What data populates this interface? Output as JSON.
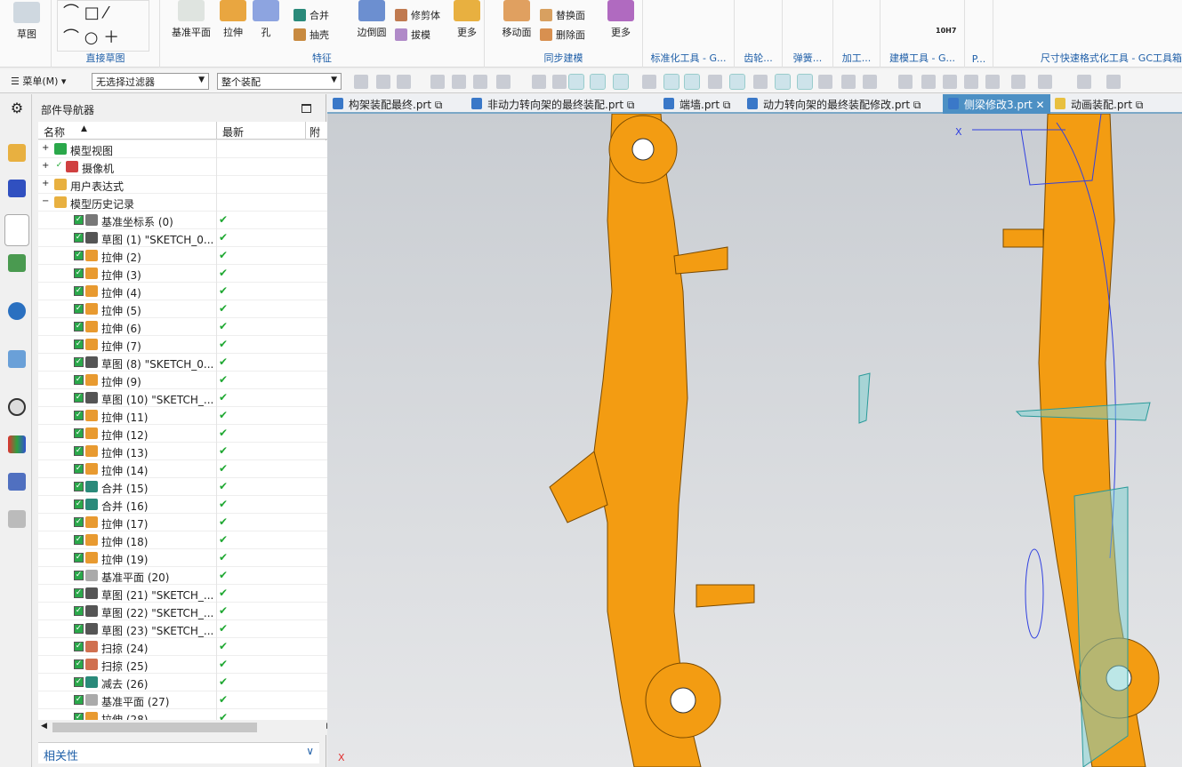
{
  "ribbon": {
    "sketch": "草图",
    "direct_sketch": "直接草图",
    "datum_plane": "基准平面",
    "extrude": "拉伸",
    "hole": "孔",
    "unite": "合并",
    "shell": "抽壳",
    "edge_blend": "边倒圆",
    "trim_body": "修剪体",
    "draft": "拔模",
    "more": "更多",
    "feature": "特征",
    "move_face": "移动面",
    "replace_face": "替换面",
    "delete_face": "删除面",
    "more2": "更多",
    "sync": "同步建模",
    "std_tools": "标准化工具 - G...",
    "gear": "齿轮...",
    "spring": "弹簧...",
    "machining": "加工...",
    "modeling_tools": "建模工具 - G...",
    "p": "P...",
    "dim_format": "尺寸快速格式化工具 - GC工具箱",
    "tol": "10H7"
  },
  "toolbar": {
    "menu": "菜单(M)",
    "filter": "无选择过滤器",
    "scope": "整个装配"
  },
  "navigator": {
    "title": "部件导航器",
    "col_name": "名称",
    "col_latest": "最新",
    "col_extra": "附",
    "rows": [
      {
        "label": "模型视图",
        "type": "view",
        "level": 0,
        "check": false
      },
      {
        "label": "摄像机",
        "type": "camera",
        "level": 0,
        "check": false
      },
      {
        "label": "用户表达式",
        "type": "folder",
        "level": 0,
        "check": false
      },
      {
        "label": "模型历史记录",
        "type": "folder",
        "level": 0,
        "check": false
      },
      {
        "label": "基准坐标系 (0)",
        "type": "csys",
        "level": 1,
        "check": true
      },
      {
        "label": "草图 (1) \"SKETCH_0...",
        "type": "sketch",
        "level": 1,
        "check": true
      },
      {
        "label": "拉伸 (2)",
        "type": "extrude",
        "level": 1,
        "check": true
      },
      {
        "label": "拉伸 (3)",
        "type": "extrude",
        "level": 1,
        "check": true
      },
      {
        "label": "拉伸 (4)",
        "type": "extrude",
        "level": 1,
        "check": true
      },
      {
        "label": "拉伸 (5)",
        "type": "extrude",
        "level": 1,
        "check": true
      },
      {
        "label": "拉伸 (6)",
        "type": "extrude",
        "level": 1,
        "check": true
      },
      {
        "label": "拉伸 (7)",
        "type": "extrude",
        "level": 1,
        "check": true
      },
      {
        "label": "草图 (8) \"SKETCH_0...",
        "type": "sketch",
        "level": 1,
        "check": true
      },
      {
        "label": "拉伸 (9)",
        "type": "extrude",
        "level": 1,
        "check": true
      },
      {
        "label": "草图 (10) \"SKETCH_...",
        "type": "sketch",
        "level": 1,
        "check": true
      },
      {
        "label": "拉伸 (11)",
        "type": "extrude",
        "level": 1,
        "check": true
      },
      {
        "label": "拉伸 (12)",
        "type": "extrude",
        "level": 1,
        "check": true
      },
      {
        "label": "拉伸 (13)",
        "type": "extrude",
        "level": 1,
        "check": true
      },
      {
        "label": "拉伸 (14)",
        "type": "extrude",
        "level": 1,
        "check": true
      },
      {
        "label": "合并 (15)",
        "type": "unite",
        "level": 1,
        "check": true
      },
      {
        "label": "合并 (16)",
        "type": "unite",
        "level": 1,
        "check": true
      },
      {
        "label": "拉伸 (17)",
        "type": "extrude",
        "level": 1,
        "check": true
      },
      {
        "label": "拉伸 (18)",
        "type": "extrude",
        "level": 1,
        "check": true
      },
      {
        "label": "拉伸 (19)",
        "type": "extrude",
        "level": 1,
        "check": true
      },
      {
        "label": "基准平面 (20)",
        "type": "plane",
        "level": 1,
        "check": true
      },
      {
        "label": "草图 (21) \"SKETCH_...",
        "type": "sketch",
        "level": 1,
        "check": true
      },
      {
        "label": "草图 (22) \"SKETCH_...",
        "type": "sketch",
        "level": 1,
        "check": true
      },
      {
        "label": "草图 (23) \"SKETCH_...",
        "type": "sketch",
        "level": 1,
        "check": true
      },
      {
        "label": "扫掠 (24)",
        "type": "sweep",
        "level": 1,
        "check": true
      },
      {
        "label": "扫掠 (25)",
        "type": "sweep",
        "level": 1,
        "check": true
      },
      {
        "label": "减去 (26)",
        "type": "subtract",
        "level": 1,
        "check": true
      },
      {
        "label": "基准平面 (27)",
        "type": "plane",
        "level": 1,
        "check": true
      },
      {
        "label": "拉伸 (28)",
        "type": "extrude",
        "level": 1,
        "check": true
      }
    ],
    "dependencies": "相关性"
  },
  "tabs": [
    {
      "label": "构架装配最终.prt",
      "active": false
    },
    {
      "label": "非动力转向架的最终装配.prt",
      "active": false
    },
    {
      "label": "端墙.prt",
      "active": false
    },
    {
      "label": "动力转向架的最终装配修改.prt",
      "active": false
    },
    {
      "label": "侧梁修改3.prt",
      "active": true
    },
    {
      "label": "动画装配.prt",
      "active": false
    }
  ],
  "viewport": {
    "axis_x": "X",
    "model_color": "#f39c12"
  }
}
